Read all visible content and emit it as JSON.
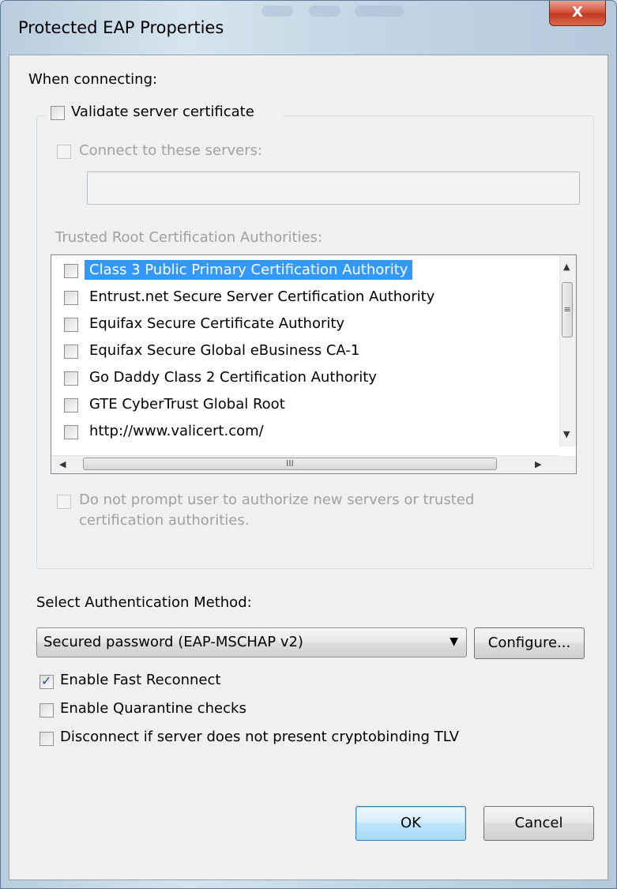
{
  "window": {
    "title": "Protected EAP Properties",
    "close_label": "X"
  },
  "labels": {
    "when_connecting": "When connecting:",
    "trusted_roots": "Trusted Root Certification Authorities:",
    "select_method": "Select Authentication Method:"
  },
  "validate_server_certificate": {
    "label": "Validate server certificate",
    "checked": false
  },
  "connect_to_servers": {
    "label": "Connect to these servers:",
    "checked": false,
    "enabled": false,
    "value": ""
  },
  "certificate_authorities": [
    {
      "name": "Class 3 Public Primary Certification Authority",
      "checked": false,
      "selected": true
    },
    {
      "name": "Entrust.net Secure Server Certification Authority",
      "checked": false,
      "selected": false
    },
    {
      "name": "Equifax Secure Certificate Authority",
      "checked": false,
      "selected": false
    },
    {
      "name": "Equifax Secure Global eBusiness CA-1",
      "checked": false,
      "selected": false
    },
    {
      "name": "Go Daddy Class 2 Certification Authority",
      "checked": false,
      "selected": false
    },
    {
      "name": "GTE CyberTrust Global Root",
      "checked": false,
      "selected": false
    },
    {
      "name": "http://www.valicert.com/",
      "checked": false,
      "selected": false
    }
  ],
  "do_not_prompt": {
    "line1": "Do not prompt user to authorize new servers or trusted",
    "line2": "certification authorities.",
    "checked": false,
    "enabled": false
  },
  "auth_method": {
    "selected": "Secured password (EAP-MSCHAP v2)"
  },
  "buttons": {
    "configure": "Configure...",
    "ok": "OK",
    "cancel": "Cancel"
  },
  "options": [
    {
      "label": "Enable Fast Reconnect",
      "checked": true
    },
    {
      "label": "Enable Quarantine checks",
      "checked": false
    },
    {
      "label": "Disconnect if server does not present cryptobinding TLV",
      "checked": false
    }
  ],
  "scrollbar_glyphs": {
    "up": "▲",
    "down": "▼",
    "left": "◀",
    "right": "▶",
    "grip_v": "≡",
    "grip_h": "III"
  },
  "colors": {
    "selection": "#3399ff",
    "disabled_text": "#a0a0a0",
    "close_button": "#c23b22"
  }
}
